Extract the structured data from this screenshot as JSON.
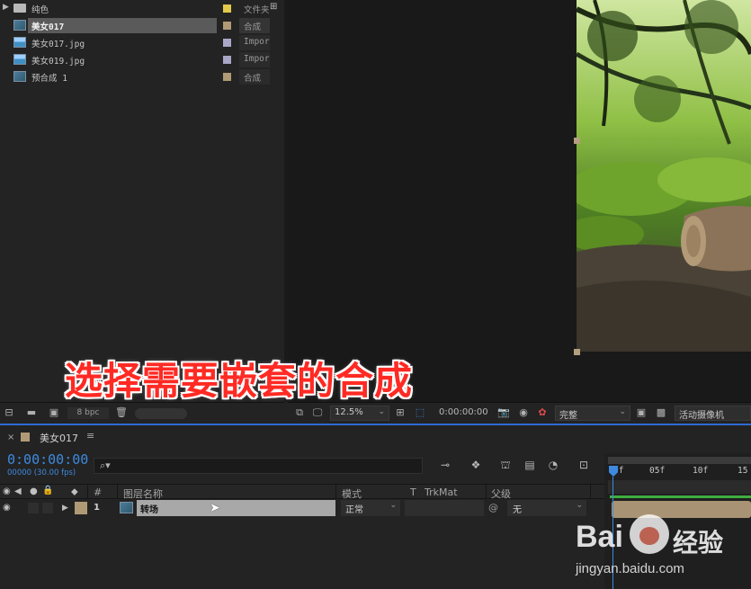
{
  "project": {
    "rows": [
      {
        "name": "纯色",
        "type": "文件夹",
        "swatch": "#e3c94a",
        "kind": "folder"
      },
      {
        "name": "美女017",
        "type": "合成",
        "swatch": "#b09a76",
        "kind": "comp",
        "selected": true
      },
      {
        "name": "美女017.jpg",
        "type": "Impor",
        "swatch": "#a9a6c8",
        "kind": "img"
      },
      {
        "name": "美女019.jpg",
        "type": "Impor",
        "swatch": "#a9a6c8",
        "kind": "img"
      },
      {
        "name": "预合成 1",
        "type": "合成",
        "swatch": "#b09a76",
        "kind": "comp"
      }
    ],
    "bpc_label": "8 bpc"
  },
  "viewer": {
    "zoom": "12.5%",
    "timecode": "0:00:00:00",
    "resolution": "完整",
    "camera": "活动摄像机"
  },
  "timeline": {
    "comp_tab": "美女017",
    "timecode": "0:00:00:00",
    "fps": "00000 (30.00 fps)",
    "search_placeholder": "",
    "headers": {
      "num": "#",
      "layer_name": "图层名称",
      "mode": "模式",
      "t": "T",
      "trkmat": "TrkMat",
      "parent": "父级"
    },
    "layer": {
      "num": "1",
      "name": "转场",
      "mode": "正常",
      "parent": "无",
      "label_color": "#b09a76"
    },
    "ruler": [
      "0f",
      "05f",
      "10f",
      "15"
    ]
  },
  "annotation": {
    "text": "选择需要嵌套的合成",
    "color": "#ff2a24"
  },
  "watermark": {
    "brand": "Bai",
    "brand2": "经验",
    "url": "jingyan.baidu.com"
  }
}
